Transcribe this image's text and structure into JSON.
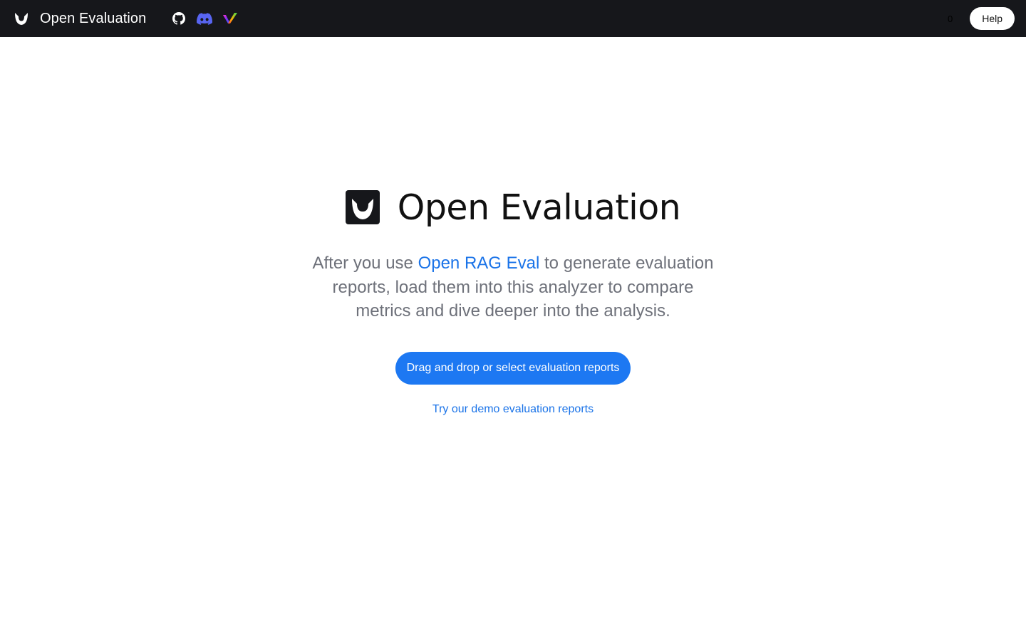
{
  "header": {
    "brand_title": "Open Evaluation",
    "social_links": [
      {
        "icon": "github-icon",
        "color": "#ffffff"
      },
      {
        "icon": "discord-icon",
        "color": "#5865f2"
      },
      {
        "icon": "vectara-icon",
        "color": "multicolor"
      }
    ],
    "counter": "0",
    "help_label": "Help",
    "background": "#16171b"
  },
  "hero": {
    "title": "Open Evaluation",
    "desc_before": "After you use ",
    "desc_link": "Open RAG Eval",
    "desc_after": " to generate evaluation reports, load them into this analyzer to compare metrics and dive deeper into the analysis.",
    "upload_label": "Drag and drop or select evaluation reports",
    "demo_label": "Try our demo evaluation reports",
    "accent": "#1d78f2"
  }
}
